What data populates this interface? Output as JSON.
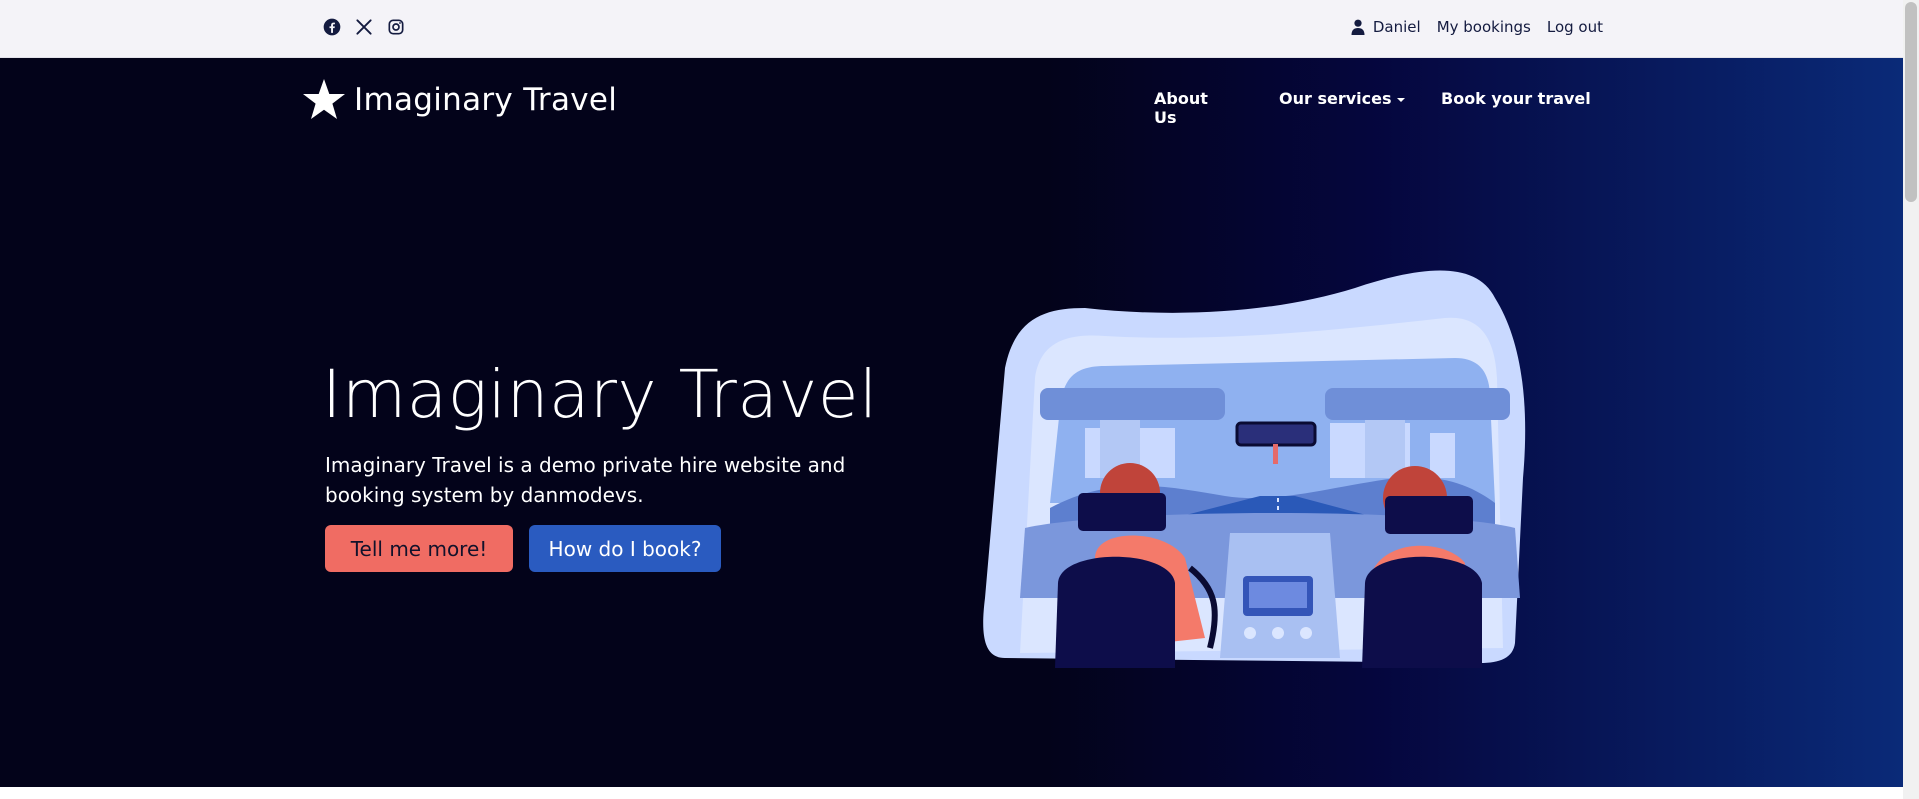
{
  "topbar": {
    "social": [
      {
        "icon": "facebook-icon"
      },
      {
        "icon": "x-twitter-icon"
      },
      {
        "icon": "instagram-icon"
      }
    ],
    "user_name": "Daniel",
    "my_bookings": "My bookings",
    "logout": "Log out"
  },
  "brand": {
    "icon": "star-icon",
    "name": "Imaginary Travel"
  },
  "nav": {
    "about": "About Us",
    "services": "Our services",
    "book": "Book your travel"
  },
  "hero": {
    "title": "Imaginary Travel",
    "subtitle": "Imaginary Travel is a demo private hire website and booking system by danmodevs.",
    "primary_button": "Tell me more!",
    "secondary_button": "How do I book?",
    "illustration": "car-interior-illustration"
  },
  "colors": {
    "hero_dark": "#03031a",
    "hero_blue": "#0a2a78",
    "button_coral": "#f06c63",
    "button_blue": "#2a5bc0",
    "topbar_bg": "#f4f3f8",
    "topbar_text": "#141b40"
  }
}
